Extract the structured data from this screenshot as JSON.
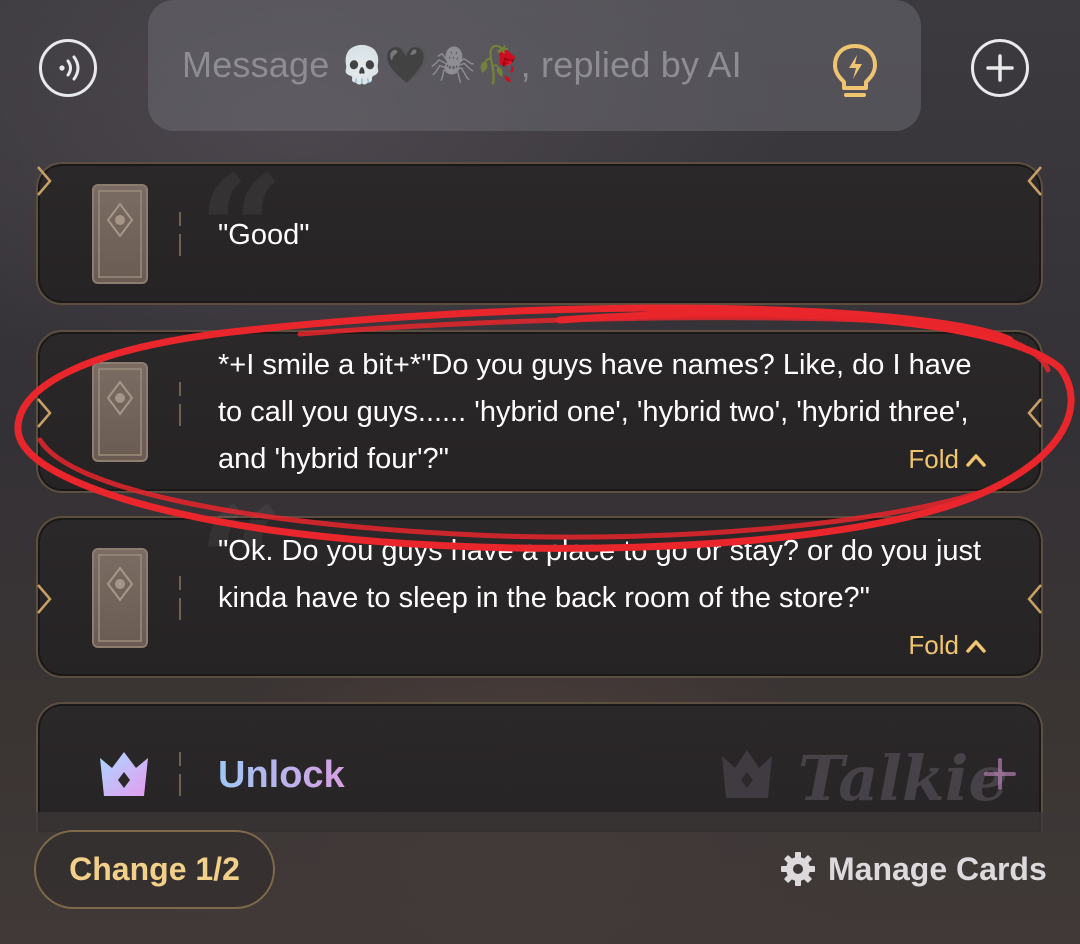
{
  "header": {
    "voice_icon": "voice-call-icon",
    "message_placeholder": "Message 💀🖤🕷🥀, replied by AI",
    "bulb_icon": "lightbulb-icon",
    "add_icon": "plus-icon"
  },
  "cards": [
    {
      "text": "\"Good\"",
      "fold_label": ""
    },
    {
      "text": "*+I smile a bit+*\"Do you guys have names? Like, do I have to call you guys...... 'hybrid one', 'hybrid two', 'hybrid three', and 'hybrid four'?\"",
      "fold_label": "Fold"
    },
    {
      "text": "\"Ok. Do you guys have a place to go or stay? or do you just kinda have to sleep in the back room of the store?\"",
      "fold_label": "Fold"
    }
  ],
  "unlock_card": {
    "label": "Unlock",
    "brand": "Talkie"
  },
  "footer": {
    "change_label": "Change 1/2",
    "manage_label": "Manage Cards"
  },
  "colors": {
    "accent_gold": "#f0c571",
    "annotation_red": "#e8262b"
  }
}
